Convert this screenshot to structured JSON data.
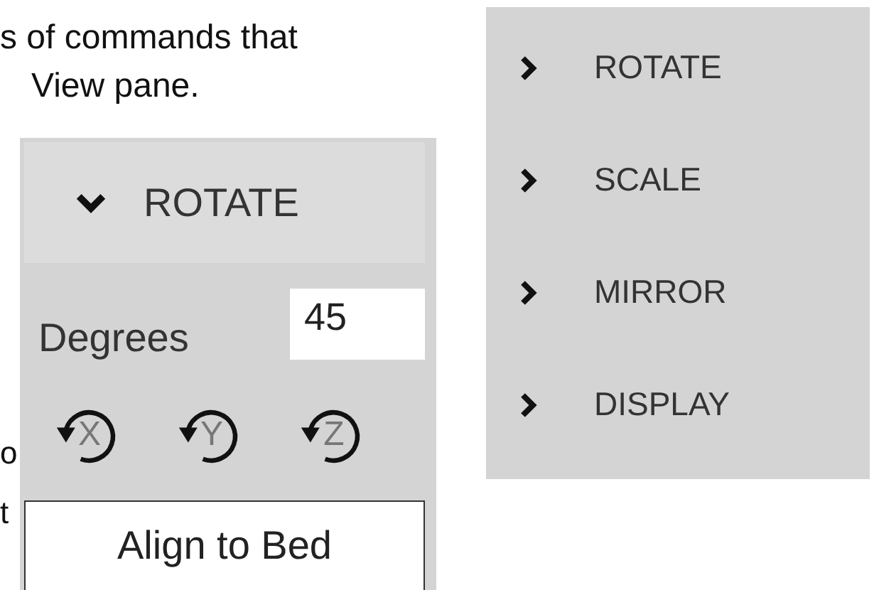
{
  "intro_text": [
    "s of commands that",
    "View pane."
  ],
  "cut_letters": [
    "o",
    "t"
  ],
  "rotate_panel": {
    "header": {
      "label": "ROTATE",
      "expanded": true
    },
    "degrees_label": "Degrees",
    "degrees_value": "45",
    "axes": [
      "X",
      "Y",
      "Z"
    ],
    "button": "Align to Bed"
  },
  "collapsed_panel": {
    "sections": [
      {
        "label": "ROTATE",
        "expanded": false
      },
      {
        "label": "SCALE",
        "expanded": false
      },
      {
        "label": "MIRROR",
        "expanded": false
      },
      {
        "label": "DISPLAY",
        "expanded": false
      }
    ]
  }
}
